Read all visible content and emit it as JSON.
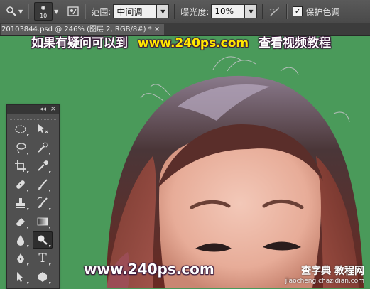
{
  "options_bar": {
    "brush_size": "10",
    "range_label": "范围:",
    "range_value": "中间调",
    "exposure_label": "曝光度:",
    "exposure_value": "10%",
    "protect_tones_label": "保护色调",
    "protect_tones_checked": true
  },
  "document_tab": {
    "title": "20103844.psd @ 246% (图层 2, RGB/8#) * ×"
  },
  "watermark": {
    "top_prefix": "如果有疑问可以到",
    "top_url": "www.240ps.com",
    "top_suffix": "查看视频教程",
    "bottom_url": "www.240ps.com",
    "logo_text": "查字典 教程网",
    "logo_domain": "jiaocheng.chazidian.com"
  },
  "tools_panel": {
    "collapse_glyph": "◂◂",
    "close_glyph": "×",
    "tools": [
      [
        "marquee-icon",
        "move-icon"
      ],
      [
        "lasso-icon",
        "quick-selection-icon"
      ],
      [
        "crop-icon",
        "eyedropper-icon"
      ],
      [
        "healing-brush-icon",
        "brush-icon"
      ],
      [
        "clone-stamp-icon",
        "history-brush-icon"
      ],
      [
        "eraser-icon",
        "gradient-icon"
      ],
      [
        "blur-icon",
        "dodge-icon"
      ],
      [
        "pen-icon",
        "type-icon"
      ],
      [
        "path-selection-icon",
        "shape-icon"
      ]
    ],
    "active_tool": "dodge-icon",
    "type_glyph": "T"
  },
  "colors": {
    "background_green": "#4a9a5a",
    "ui_dark": "#4a4a4a",
    "watermark_yellow": "#ffe800"
  }
}
